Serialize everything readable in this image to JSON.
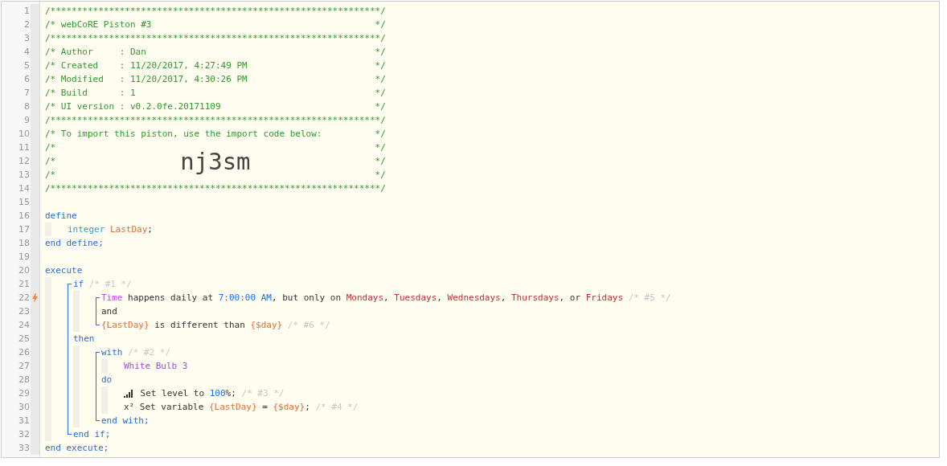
{
  "gutter": [
    {
      "number": "1",
      "trigger": false
    },
    {
      "number": "2",
      "trigger": false
    },
    {
      "number": "3",
      "trigger": false
    },
    {
      "number": "4",
      "trigger": false
    },
    {
      "number": "5",
      "trigger": false
    },
    {
      "number": "6",
      "trigger": false
    },
    {
      "number": "7",
      "trigger": false
    },
    {
      "number": "8",
      "trigger": false
    },
    {
      "number": "9",
      "trigger": false
    },
    {
      "number": "10",
      "trigger": false
    },
    {
      "number": "11",
      "trigger": false
    },
    {
      "number": "12",
      "trigger": false
    },
    {
      "number": "13",
      "trigger": false
    },
    {
      "number": "14",
      "trigger": false
    },
    {
      "number": "15",
      "trigger": false
    },
    {
      "number": "16",
      "trigger": false
    },
    {
      "number": "17",
      "trigger": false
    },
    {
      "number": "18",
      "trigger": false
    },
    {
      "number": "19",
      "trigger": false
    },
    {
      "number": "20",
      "trigger": false
    },
    {
      "number": "21",
      "trigger": false
    },
    {
      "number": "22",
      "trigger": true
    },
    {
      "number": "23",
      "trigger": false
    },
    {
      "number": "24",
      "trigger": false
    },
    {
      "number": "25",
      "trigger": false
    },
    {
      "number": "26",
      "trigger": false
    },
    {
      "number": "27",
      "trigger": false
    },
    {
      "number": "28",
      "trigger": false
    },
    {
      "number": "29",
      "trigger": false
    },
    {
      "number": "30",
      "trigger": false
    },
    {
      "number": "31",
      "trigger": false
    },
    {
      "number": "32",
      "trigger": false
    },
    {
      "number": "33",
      "trigger": false
    }
  ],
  "code": [
    {
      "kind": "line",
      "tokens": [
        {
          "kind": "comment",
          "text": "/**************************************************************/"
        }
      ]
    },
    {
      "kind": "framed",
      "tokens": [
        {
          "kind": "comment",
          "text": "/* webCoRE Piston #3"
        },
        {
          "kind": "comment",
          "text": "*/"
        }
      ]
    },
    {
      "kind": "line",
      "tokens": [
        {
          "kind": "comment",
          "text": "/**************************************************************/"
        }
      ]
    },
    {
      "kind": "framed",
      "tokens": [
        {
          "kind": "comment",
          "text": "/* Author     : Dan"
        },
        {
          "kind": "comment",
          "text": "*/"
        }
      ]
    },
    {
      "kind": "framed",
      "tokens": [
        {
          "kind": "comment",
          "text": "/* Created    : 11/20/2017, 4:27:49 PM"
        },
        {
          "kind": "comment",
          "text": "*/"
        }
      ]
    },
    {
      "kind": "framed",
      "tokens": [
        {
          "kind": "comment",
          "text": "/* Modified   : 11/20/2017, 4:30:26 PM"
        },
        {
          "kind": "comment",
          "text": "*/"
        }
      ]
    },
    {
      "kind": "framed",
      "tokens": [
        {
          "kind": "comment",
          "text": "/* Build      : 1"
        },
        {
          "kind": "comment",
          "text": "*/"
        }
      ]
    },
    {
      "kind": "framed",
      "tokens": [
        {
          "kind": "comment",
          "text": "/* UI version : v0.2.0fe.20171109"
        },
        {
          "kind": "comment",
          "text": "*/"
        }
      ]
    },
    {
      "kind": "line",
      "tokens": [
        {
          "kind": "comment",
          "text": "/**************************************************************/"
        }
      ]
    },
    {
      "kind": "framed",
      "tokens": [
        {
          "kind": "comment",
          "text": "/* To import this piston, use the import code below:"
        },
        {
          "kind": "comment",
          "text": "*/"
        }
      ]
    },
    {
      "kind": "framed",
      "tokens": [
        {
          "kind": "comment",
          "text": "/*"
        },
        {
          "kind": "comment",
          "text": "*/"
        }
      ]
    },
    {
      "kind": "framed",
      "tokens": [
        {
          "kind": "comment",
          "text": "/*"
        },
        {
          "kind": "code",
          "text": "nj3sm"
        },
        {
          "kind": "comment",
          "text": "*/"
        }
      ]
    },
    {
      "kind": "framed",
      "tokens": [
        {
          "kind": "comment",
          "text": "/*"
        },
        {
          "kind": "comment",
          "text": "*/"
        }
      ]
    },
    {
      "kind": "line",
      "tokens": [
        {
          "kind": "comment",
          "text": "/**************************************************************/"
        }
      ]
    },
    {
      "kind": "line"
    },
    {
      "kind": "line",
      "tokens": [
        {
          "kind": "keyword",
          "text": "define"
        }
      ]
    },
    {
      "kind": "block",
      "children": [
        {
          "kind": "line",
          "tokens": [
            {
              "kind": "type",
              "text": "integer"
            },
            {
              "kind": "variable",
              "text": "LastDay"
            },
            {
              "kind": "plain",
              "text": ";"
            }
          ]
        }
      ]
    },
    {
      "kind": "line",
      "tokens": [
        {
          "kind": "keyword",
          "text": "end define;"
        }
      ]
    },
    {
      "kind": "line"
    },
    {
      "kind": "line",
      "tokens": [
        {
          "kind": "keyword",
          "text": "execute"
        }
      ]
    },
    {
      "kind": "block",
      "children": [
        {
          "kind": "bracket",
          "children": [
            {
              "kind": "line",
              "tokens": [
                {
                  "kind": "keyword",
                  "text": "if"
                },
                {
                  "kind": "note",
                  "text": "/* #1 */"
                }
              ]
            },
            {
              "kind": "block",
              "children": [
                {
                  "kind": "bracket",
                  "children": [
                    {
                      "kind": "line",
                      "tokens": [
                        {
                          "kind": "attribute",
                          "text": "Time"
                        },
                        {
                          "kind": "plain",
                          "text": " happens daily at "
                        },
                        {
                          "kind": "value",
                          "text": "7:00:00 AM"
                        },
                        {
                          "kind": "plain",
                          "text": ", but only on "
                        },
                        {
                          "kind": "day",
                          "text": "Mondays"
                        },
                        {
                          "kind": "plain",
                          "text": ", "
                        },
                        {
                          "kind": "day",
                          "text": "Tuesdays"
                        },
                        {
                          "kind": "plain",
                          "text": ", "
                        },
                        {
                          "kind": "day",
                          "text": "Wednesdays"
                        },
                        {
                          "kind": "plain",
                          "text": ", "
                        },
                        {
                          "kind": "day",
                          "text": "Thursdays"
                        },
                        {
                          "kind": "plain",
                          "text": ", or "
                        },
                        {
                          "kind": "day",
                          "text": "Fridays"
                        },
                        {
                          "kind": "note",
                          "text": "/* #5 */"
                        }
                      ]
                    },
                    {
                      "kind": "line",
                      "tokens": [
                        {
                          "kind": "plain",
                          "text": "and"
                        }
                      ]
                    },
                    {
                      "kind": "line",
                      "tokens": [
                        {
                          "kind": "variable",
                          "text": "{LastDay}"
                        },
                        {
                          "kind": "plain",
                          "text": " is different than "
                        },
                        {
                          "kind": "variable",
                          "text": "{$day}"
                        },
                        {
                          "kind": "note",
                          "text": "/* #6 */"
                        }
                      ]
                    }
                  ]
                }
              ]
            },
            {
              "kind": "line",
              "tokens": [
                {
                  "kind": "keyword",
                  "text": "then"
                }
              ]
            },
            {
              "kind": "block",
              "children": [
                {
                  "kind": "bracket",
                  "children": [
                    {
                      "kind": "line",
                      "tokens": [
                        {
                          "kind": "keyword",
                          "text": "with"
                        },
                        {
                          "kind": "note",
                          "text": "/* #2 */"
                        }
                      ]
                    },
                    {
                      "kind": "block",
                      "children": [
                        {
                          "kind": "line",
                          "tokens": [
                            {
                              "kind": "device",
                              "text": "White Bulb 3"
                            }
                          ]
                        }
                      ]
                    },
                    {
                      "kind": "line",
                      "tokens": [
                        {
                          "kind": "keyword",
                          "text": "do"
                        }
                      ]
                    },
                    {
                      "kind": "block",
                      "children": [
                        {
                          "kind": "line",
                          "tokens": [
                            {
                              "kind": "bars-icon"
                            },
                            {
                              "kind": "plain",
                              "text": " Set level to "
                            },
                            {
                              "kind": "value",
                              "text": "100"
                            },
                            {
                              "kind": "plain",
                              "text": "%;"
                            },
                            {
                              "kind": "note",
                              "text": "/* #3 */"
                            }
                          ]
                        },
                        {
                          "kind": "line",
                          "tokens": [
                            {
                              "kind": "plain",
                              "text": "x² Set variable "
                            },
                            {
                              "kind": "variable",
                              "text": "{LastDay}"
                            },
                            {
                              "kind": "plain",
                              "text": " = "
                            },
                            {
                              "kind": "variable",
                              "text": "{$day}"
                            },
                            {
                              "kind": "plain",
                              "text": ";"
                            },
                            {
                              "kind": "note",
                              "text": "/* #4 */"
                            }
                          ]
                        }
                      ]
                    },
                    {
                      "kind": "line",
                      "tokens": [
                        {
                          "kind": "keyword",
                          "text": "end with;"
                        }
                      ]
                    }
                  ]
                }
              ]
            },
            {
              "kind": "line",
              "tokens": [
                {
                  "kind": "keyword",
                  "text": "end if;"
                }
              ]
            }
          ]
        }
      ]
    },
    {
      "kind": "line",
      "tokens": [
        {
          "kind": "keyword",
          "text": "end execute;"
        }
      ]
    }
  ]
}
